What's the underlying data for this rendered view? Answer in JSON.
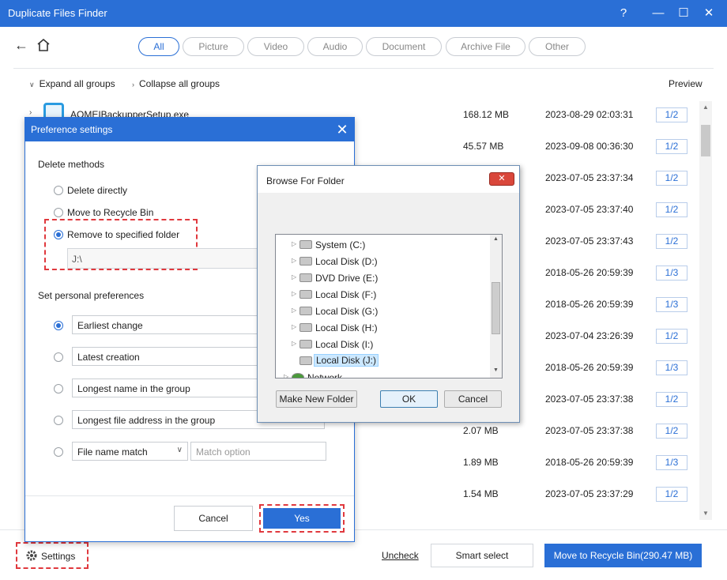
{
  "app": {
    "title": "Duplicate Files Finder"
  },
  "window_controls": {
    "help": "?",
    "minimize": "—",
    "maximize": "☐",
    "close": "✕"
  },
  "filters": [
    {
      "label": "All",
      "active": true
    },
    {
      "label": "Picture"
    },
    {
      "label": "Video"
    },
    {
      "label": "Audio"
    },
    {
      "label": "Document"
    },
    {
      "label": "Archive File"
    },
    {
      "label": "Other"
    }
  ],
  "groupbar": {
    "expand_label": "Expand all groups",
    "collapse_label": "Collapse all groups",
    "preview_label": "Preview"
  },
  "files": [
    {
      "name": "AOMEIBackupperSetup.exe",
      "size": "168.12 MB",
      "date": "2023-08-29 02:03:31",
      "count": "1/2"
    },
    {
      "name": "",
      "size": "45.57 MB",
      "date": "2023-09-08 00:36:30",
      "count": "1/2"
    },
    {
      "name": "",
      "size": "",
      "date": "2023-07-05 23:37:34",
      "count": "1/2"
    },
    {
      "name": "",
      "size": "",
      "date": "2023-07-05 23:37:40",
      "count": "1/2"
    },
    {
      "name": "",
      "size": "",
      "date": "2023-07-05 23:37:43",
      "count": "1/2"
    },
    {
      "name": "",
      "size": "",
      "date": "2018-05-26 20:59:39",
      "count": "1/3"
    },
    {
      "name": "",
      "size": "",
      "date": "2018-05-26 20:59:39",
      "count": "1/3"
    },
    {
      "name": "",
      "size": "",
      "date": "2023-07-04 23:26:39",
      "count": "1/2"
    },
    {
      "name": "",
      "size": "",
      "date": "2018-05-26 20:59:39",
      "count": "1/3"
    },
    {
      "name": "",
      "size": "",
      "date": "2023-07-05 23:37:38",
      "count": "1/2"
    },
    {
      "name": "",
      "size": "2.07 MB",
      "date": "2023-07-05 23:37:38",
      "count": "1/2"
    },
    {
      "name": "",
      "size": "1.89 MB",
      "date": "2018-05-26 20:59:39",
      "count": "1/3"
    },
    {
      "name": "",
      "size": "1.54 MB",
      "date": "2023-07-05 23:37:29",
      "count": "1/2"
    }
  ],
  "bottombar": {
    "settings_label": "Settings",
    "uncheck_label": "Uncheck",
    "smart_select_label": "Smart select",
    "move_label": "Move to Recycle Bin(290.47 MB)"
  },
  "preference": {
    "title": "Preference settings",
    "close": "✕",
    "delete_methods_title": "Delete methods",
    "delete_directly": "Delete directly",
    "move_recycle": "Move to Recycle Bin",
    "remove_folder": "Remove to specified folder",
    "folder_path": "J:\\",
    "personal_title": "Set personal preferences",
    "options": [
      "Earliest change",
      "Latest creation",
      "Longest name in the group",
      "Longest file address in the group",
      "File name match"
    ],
    "match_placeholder": "Match option",
    "cancel": "Cancel",
    "yes": "Yes"
  },
  "browse": {
    "title": "Browse For Folder",
    "close": "✕",
    "drives": [
      "System (C:)",
      "Local Disk (D:)",
      "DVD Drive (E:)",
      "Local Disk (F:)",
      "Local Disk (G:)",
      "Local Disk (H:)",
      "Local Disk (I:)",
      "Local Disk (J:)",
      "Network"
    ],
    "make_new_folder": "Make New Folder",
    "ok": "OK",
    "cancel": "Cancel"
  }
}
